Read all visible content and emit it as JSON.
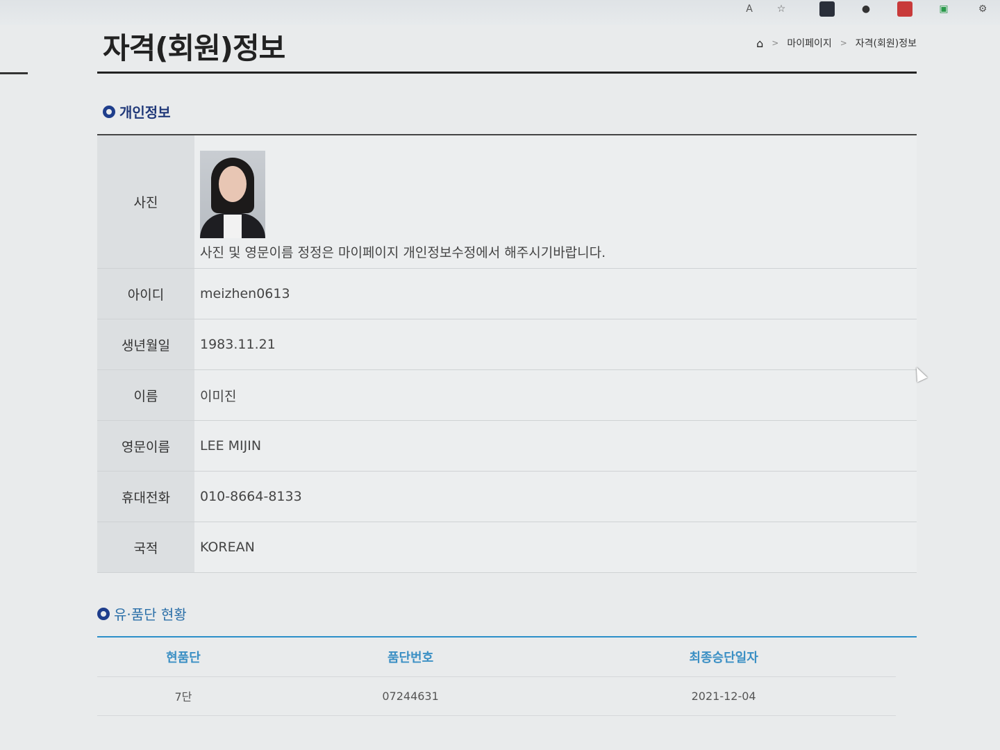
{
  "toolbar": {
    "icons": [
      "read-aloud-icon",
      "favorites-add-icon",
      "extension-icon",
      "chat-icon",
      "extension-red-icon",
      "extension-green-icon",
      "settings-icon"
    ]
  },
  "page": {
    "title": "자격(회원)정보",
    "breadcrumb": {
      "home_icon": "home-icon",
      "items": [
        "마이페이지",
        "자격(회원)정보"
      ],
      "separator": ">"
    }
  },
  "personal_info": {
    "section_title": "개인정보",
    "photo_label": "사진",
    "photo_note": "사진 및 영문이름 정정은 마이페이지 개인정보수정에서 해주시기바랍니다.",
    "rows": [
      {
        "label": "아이디",
        "value": "meizhen0613"
      },
      {
        "label": "생년월일",
        "value": "1983.11.21"
      },
      {
        "label": "이름",
        "value": "이미진"
      },
      {
        "label": "영문이름",
        "value": "LEE MIJIN"
      },
      {
        "label": "휴대전화",
        "value": "010-8664-8133"
      },
      {
        "label": "국적",
        "value": "KOREAN"
      }
    ]
  },
  "rank_status": {
    "section_title": "유·품단 현황",
    "headers": [
      "현품단",
      "품단번호",
      "최종승단일자"
    ],
    "rows": [
      [
        "7단",
        "07244631",
        "2021-12-04"
      ]
    ]
  },
  "colors": {
    "title_blue": "#223a7a",
    "accent_blue": "#2b8fc9",
    "header_text_blue": "#3a8fc4"
  }
}
